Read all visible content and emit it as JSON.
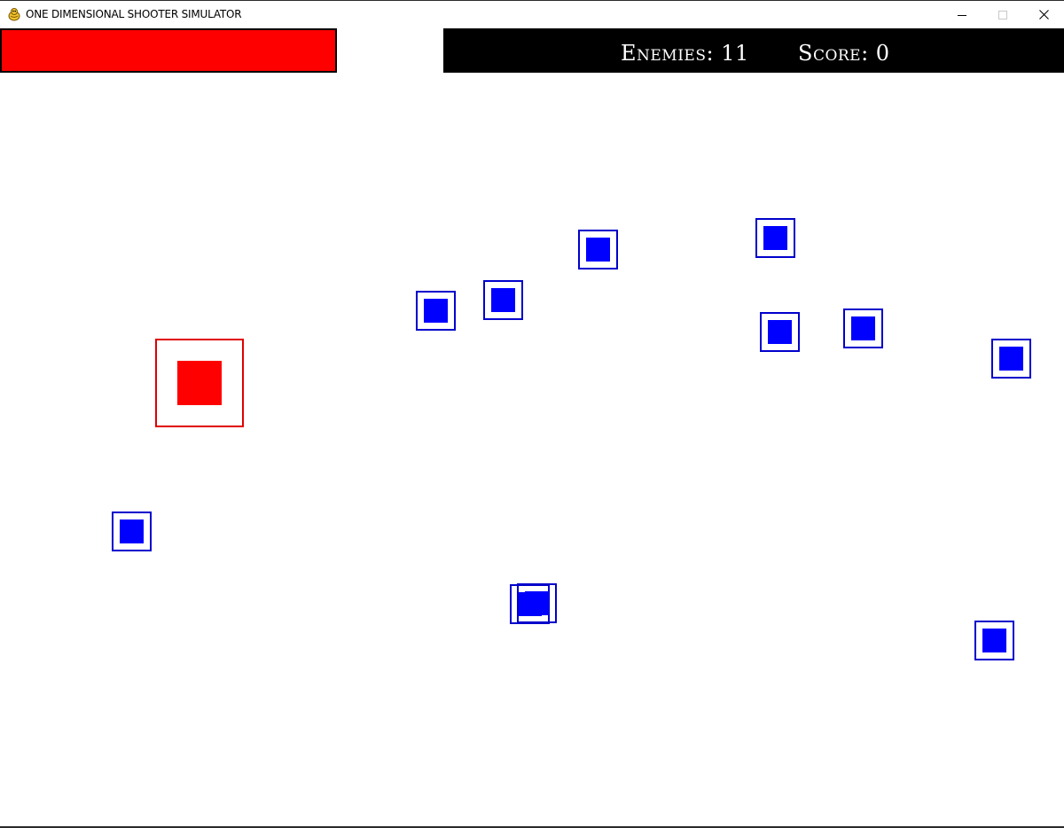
{
  "window": {
    "title": "ONE DIMENSIONAL SHOOTER SIMULATOR",
    "app_icon": "pygame-snake-icon",
    "controls": {
      "minimize_icon": "minimize-icon",
      "maximize_icon": "maximize-icon",
      "close_icon": "close-icon"
    }
  },
  "hud": {
    "enemies_text": "Enemies: 11",
    "score_text": "Score: 0",
    "enemies_count": 11,
    "score": 0,
    "health_fraction": 1.0
  },
  "colors": {
    "player": "#ff0000",
    "enemy": "#0000ff",
    "hud_background": "#000000",
    "hud_text": "#ffffff",
    "health_bar": "#ff0000"
  }
}
